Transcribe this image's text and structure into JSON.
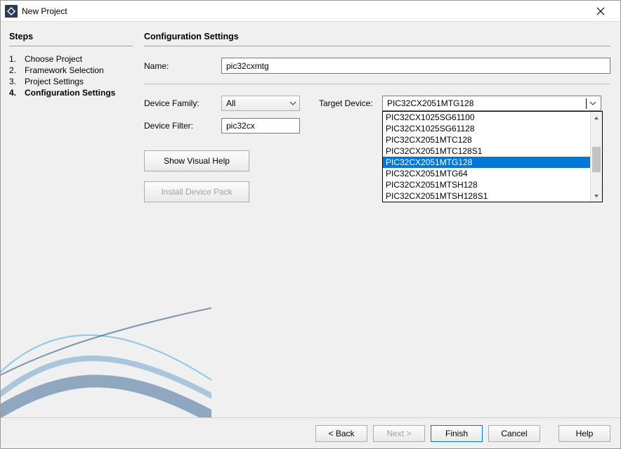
{
  "window": {
    "title": "New Project"
  },
  "sidebar": {
    "heading": "Steps",
    "items": [
      {
        "num": "1.",
        "label": "Choose Project"
      },
      {
        "num": "2.",
        "label": "Framework Selection"
      },
      {
        "num": "3.",
        "label": "Project Settings"
      },
      {
        "num": "4.",
        "label": "Configuration Settings"
      }
    ],
    "current_index": 3
  },
  "main": {
    "heading": "Configuration Settings",
    "name_label": "Name:",
    "name_value": "pic32cxmtg",
    "device_family_label": "Device Family:",
    "device_family_value": "All",
    "device_filter_label": "Device Filter:",
    "device_filter_value": "pic32cx",
    "target_device_label": "Target Device:",
    "target_device_value": "PIC32CX2051MTG128",
    "target_device_options": [
      "PIC32CX1025SG61100",
      "PIC32CX1025SG61128",
      "PIC32CX2051MTC128",
      "PIC32CX2051MTC128S1",
      "PIC32CX2051MTG128",
      "PIC32CX2051MTG64",
      "PIC32CX2051MTSH128",
      "PIC32CX2051MTSH128S1"
    ],
    "target_device_selected_index": 4,
    "show_visual_help": "Show Visual Help",
    "install_device_pack": "Install Device Pack"
  },
  "footer": {
    "back": "< Back",
    "next": "Next >",
    "finish": "Finish",
    "cancel": "Cancel",
    "help": "Help"
  }
}
